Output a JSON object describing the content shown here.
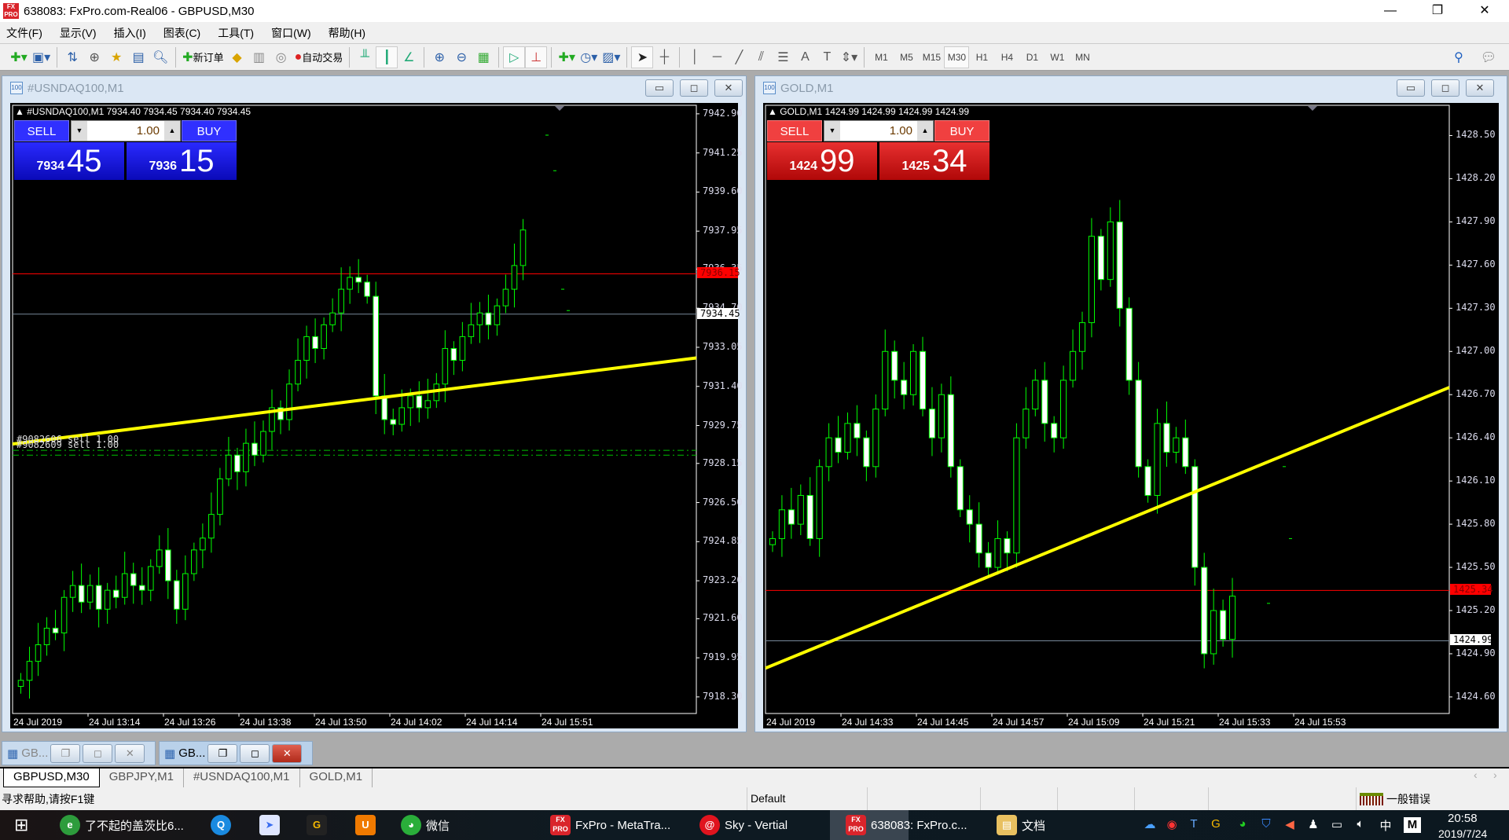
{
  "app": {
    "title": "638083: FxPro.com-Real06 - GBPUSD,M30",
    "logo": "FX PRO"
  },
  "menu": [
    "文件(F)",
    "显示(V)",
    "插入(I)",
    "图表(C)",
    "工具(T)",
    "窗口(W)",
    "帮助(H)"
  ],
  "toolbar": {
    "new_order": "新订单",
    "auto_trading": "自动交易",
    "timeframes": [
      "M1",
      "M5",
      "M15",
      "M30",
      "H1",
      "H4",
      "D1",
      "W1",
      "MN"
    ],
    "active_timeframe": "M30"
  },
  "windows": [
    {
      "title": "#USNDAQ100,M1",
      "header": "#USNDAQ100,M1  7934.40 7934.45 7934.40 7934.45",
      "panel_color": "#1414d8",
      "lot": "1.00",
      "sell_label": "SELL",
      "buy_label": "BUY",
      "sell_small": "7934",
      "sell_big": "45",
      "buy_small": "7936",
      "buy_big": "15",
      "order_labels": [
        "#9082606 sell 1.00",
        "#9082609 sell 1.00"
      ],
      "ask_label": "7936.15",
      "bid_label": "7934.45"
    },
    {
      "title": "GOLD,M1",
      "header": "GOLD,M1  1424.99 1424.99 1424.99 1424.99",
      "panel_color": "#d42020",
      "lot": "1.00",
      "sell_label": "SELL",
      "buy_label": "BUY",
      "sell_small": "1424",
      "sell_big": "99",
      "buy_small": "1425",
      "buy_big": "34",
      "ask_label": "1425.34",
      "bid_label": "1424.99"
    }
  ],
  "chart_data": [
    {
      "type": "candlestick",
      "symbol": "#USNDAQ100,M1",
      "ylim": [
        7917.6,
        7943.26
      ],
      "yticks": [
        "7942.90",
        "7941.25",
        "7939.60",
        "7937.95",
        "7936.35",
        "7934.70",
        "7933.05",
        "7931.40",
        "7929.75",
        "7928.15",
        "7926.50",
        "7924.85",
        "7923.20",
        "7921.60",
        "7919.95",
        "7918.30"
      ],
      "xticks": [
        "24 Jul 2019",
        "24 Jul 13:14",
        "24 Jul 13:26",
        "24 Jul 13:38",
        "24 Jul 13:50",
        "24 Jul 14:02",
        "24 Jul 14:14",
        "24 Jul 15:51"
      ],
      "closes": [
        7919.0,
        7919.8,
        7920.5,
        7921.2,
        7921.0,
        7922.5,
        7923.0,
        7922.3,
        7923.0,
        7922.0,
        7922.8,
        7922.5,
        7923.5,
        7923.0,
        7922.8,
        7923.8,
        7924.5,
        7923.2,
        7922.0,
        7923.5,
        7924.5,
        7925.0,
        7926.0,
        7927.5,
        7928.5,
        7927.8,
        7929.0,
        7928.5,
        7929.5,
        7930.5,
        7930.0,
        7931.5,
        7932.5,
        7933.5,
        7933.0,
        7934.0,
        7934.5,
        7935.5,
        7936.0,
        7935.8,
        7935.2,
        7931.0,
        7930.0,
        7929.8,
        7930.5,
        7931.0,
        7930.5,
        7930.8,
        7931.5,
        7933.0,
        7932.5,
        7933.5,
        7934.0,
        7934.5,
        7934.0,
        7934.8,
        7935.5,
        7936.5,
        7938.0
      ],
      "ticks_after": [
        7942.0,
        7940.5,
        7935.5,
        7934.6
      ],
      "trendline": [
        7928.97,
        7932.6
      ],
      "ask": 7936.15,
      "bid": 7934.45,
      "order_lines": [
        7928.7,
        7928.5
      ],
      "colors": {
        "up": "#00ff00",
        "down": "#00ff00",
        "trend": "#ffff00",
        "ask": "#ff0000",
        "bid": "#778899",
        "order": "#00c000"
      }
    },
    {
      "type": "candlestick",
      "symbol": "GOLD,M1",
      "ylim": [
        1424.485,
        1428.71
      ],
      "yticks": [
        "1428.50",
        "1428.20",
        "1427.90",
        "1427.60",
        "1427.30",
        "1427.00",
        "1426.70",
        "1426.40",
        "1426.10",
        "1425.80",
        "1425.50",
        "1425.20",
        "1424.90",
        "1424.60"
      ],
      "xticks": [
        "24 Jul 2019",
        "24 Jul 14:33",
        "24 Jul 14:45",
        "24 Jul 14:57",
        "24 Jul 15:09",
        "24 Jul 15:21",
        "24 Jul 15:33",
        "24 Jul 15:53"
      ],
      "closes": [
        1425.7,
        1425.9,
        1425.8,
        1426.0,
        1425.7,
        1426.2,
        1426.4,
        1426.3,
        1426.5,
        1426.4,
        1426.2,
        1426.6,
        1427.0,
        1426.8,
        1426.7,
        1427.0,
        1426.6,
        1426.4,
        1426.7,
        1426.2,
        1425.9,
        1425.8,
        1425.6,
        1425.5,
        1425.7,
        1425.6,
        1426.4,
        1426.6,
        1426.8,
        1426.5,
        1426.4,
        1426.8,
        1427.0,
        1427.2,
        1427.8,
        1427.5,
        1427.9,
        1427.3,
        1426.8,
        1426.2,
        1426.0,
        1426.5,
        1426.3,
        1426.4,
        1426.2,
        1425.5,
        1424.9,
        1425.2,
        1425.0,
        1425.3
      ],
      "ticks_after": [
        1425.25,
        1426.2,
        1425.7
      ],
      "trendline": [
        1424.8,
        1426.75
      ],
      "ask": 1425.34,
      "bid": 1424.99,
      "colors": {
        "up": "#00ff00",
        "down": "#00ff00",
        "trend": "#ffff00",
        "ask": "#ff0000",
        "bid": "#778899"
      }
    }
  ],
  "minimized": [
    "GB...",
    "GB..."
  ],
  "tabs": [
    "GBPUSD,M30",
    "GBPJPY,M1",
    "#USNDAQ100,M1",
    "GOLD,M1"
  ],
  "active_tab": "GBPUSD,M30",
  "status": {
    "help": "寻求帮助,请按F1键",
    "profile": "Default",
    "connection": "一般错误"
  },
  "taskbar": {
    "items": [
      {
        "label": "了不起的盖茨比6...",
        "icon": "chrome-icon"
      },
      {
        "label": "",
        "icon": "browser-icon"
      },
      {
        "label": "",
        "icon": "feishu-icon"
      },
      {
        "label": "",
        "icon": "app-icon"
      },
      {
        "label": "",
        "icon": "uc-icon"
      },
      {
        "label": "微信",
        "icon": "wechat-icon"
      },
      {
        "label": "FxPro - MetaTra...",
        "icon": "fxpro-icon"
      },
      {
        "label": "Sky - Vertial",
        "icon": "netease-music-icon"
      },
      {
        "label": "638083: FxPro.c...",
        "icon": "fxpro-icon"
      },
      {
        "label": "文档",
        "icon": "folder-icon"
      }
    ],
    "time": "20:58",
    "date": "2019/7/24",
    "ime": "中"
  }
}
